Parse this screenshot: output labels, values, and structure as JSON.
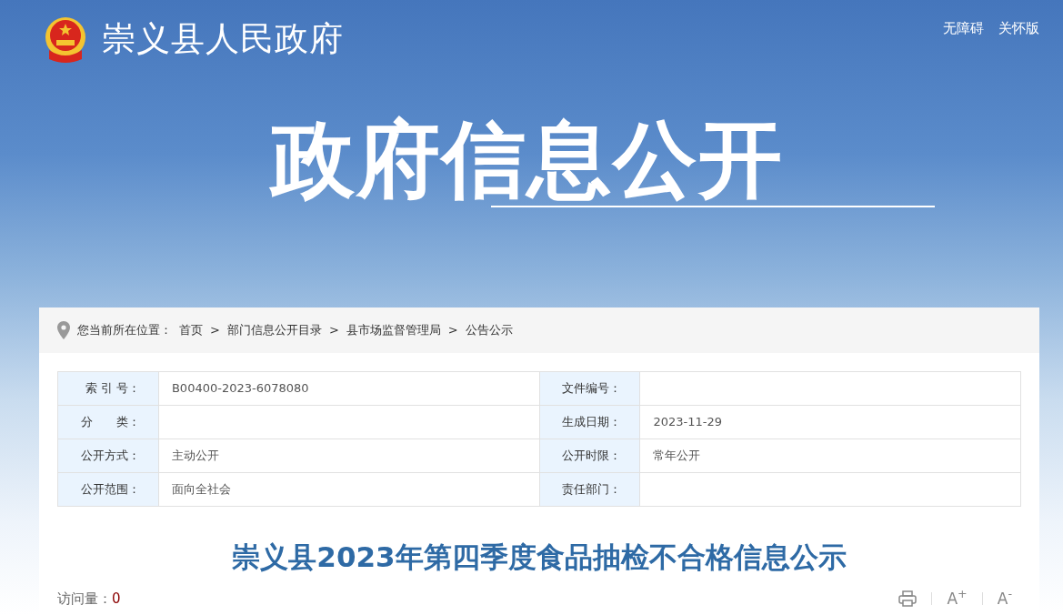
{
  "header": {
    "site_title": "崇义县人民政府",
    "links": [
      "无障碍",
      "关怀版"
    ],
    "banner_title": "政府信息公开"
  },
  "breadcrumb": {
    "label": "您当前所在位置：",
    "items": [
      "首页",
      "部门信息公开目录",
      "县市场监督管理局",
      "公告公示"
    ],
    "separator": ">"
  },
  "info_table": [
    {
      "label": "索 引 号：",
      "value": "B00400-2023-6078080",
      "label_2": "文件编号："
    },
    {
      "label": "分　　类：",
      "label_2": "生成日期：",
      "value_2": "2023-11-29"
    },
    {
      "label": "公开方式：",
      "value": "主动公开",
      "label_2": "公开时限：",
      "value_2": "常年公开"
    },
    {
      "label": "公开范围：",
      "value": "面向全社会",
      "label_2": "责任部门："
    }
  ],
  "article": {
    "title": "崇义县2023年第四季度食品抽检不合格信息公示",
    "visits_label": "访问量：",
    "visits": "0",
    "tools": [
      {
        "kind": "print"
      },
      {
        "kind": "text",
        "text": "A$^{+}$"
      },
      {
        "kind": "text",
        "text": "A$^{-}$"
      }
    ]
  }
}
